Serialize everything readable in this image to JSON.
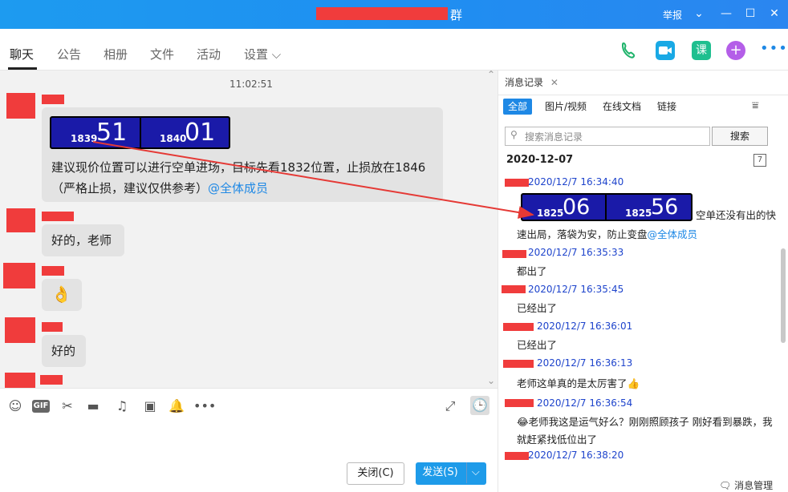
{
  "window": {
    "title_suffix": "群",
    "report": "举报",
    "min": "—",
    "max": "☐",
    "close": "✕",
    "expand": "⌄"
  },
  "tabs": [
    {
      "label": "聊天"
    },
    {
      "label": "公告"
    },
    {
      "label": "相册"
    },
    {
      "label": "文件"
    },
    {
      "label": "活动"
    },
    {
      "label": "设置 ⌵"
    }
  ],
  "chat": {
    "time": "11:02:51",
    "msg1": {
      "ticker": {
        "small1": "1839",
        "big1": "51",
        "small2": "1840",
        "big2": "01"
      },
      "text": "建议现价位置可以进行空单进场，目标先看1832位置，止损放在1846（严格止损，建议仅供参考）",
      "mention": "@全体成员"
    },
    "msg2": "好的，老师",
    "msg3": "👌",
    "msg4": "好的"
  },
  "composer": {
    "close": "关闭(C)",
    "send": "发送(S)",
    "send_arrow": "⌵"
  },
  "history": {
    "tab": "消息记录",
    "tab_close": "✕",
    "filters": [
      "全部",
      "图片/视频",
      "在线文档",
      "链接"
    ],
    "search_placeholder": "搜索消息记录",
    "search_btn": "搜索",
    "date": "2020-12-07",
    "items": [
      {
        "time": "2020/12/7 16:34:40",
        "text1": "空单还没有出的快",
        "text2": "速出局，落袋为安，防止变盘",
        "mention": "@全体成员",
        "ticker": {
          "small1": "1825",
          "big1": "06",
          "small2": "1825",
          "big2": "56"
        }
      },
      {
        "time": "2020/12/7 16:35:33",
        "text": "都出了"
      },
      {
        "time": "2020/12/7 16:35:45",
        "text": "已经出了"
      },
      {
        "time": "2020/12/7 16:36:01",
        "text": "已经出了"
      },
      {
        "time": "2020/12/7 16:36:13",
        "text": "老师这单真的是太厉害了👍"
      },
      {
        "time": "2020/12/7 16:36:54",
        "text": "😂老师我这是运气好么？刚刚照顾孩子 刚好看到暴跌，我就赶紧找低位出了"
      },
      {
        "time": "2020/12/7 16:38:20",
        "text": ""
      }
    ],
    "footer": "消息管理"
  },
  "colors": {
    "accent": "#1e88e5",
    "redact": "#f03c3c",
    "ticker": "#1a1aa8",
    "arrow": "#e53935"
  }
}
